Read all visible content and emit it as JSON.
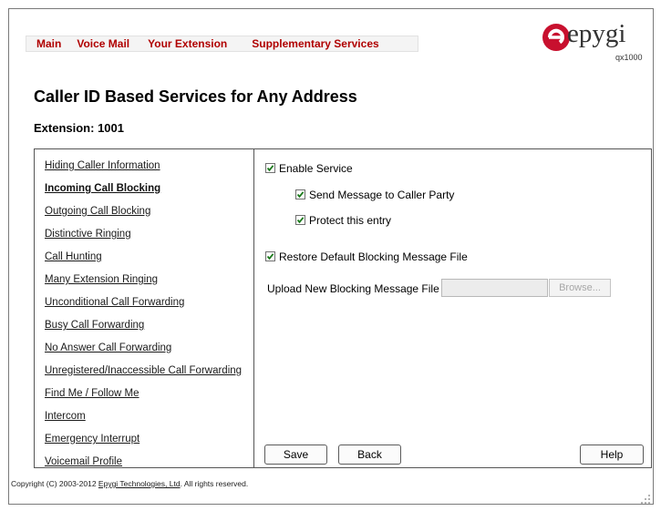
{
  "nav": {
    "tabs": [
      {
        "label": "Main"
      },
      {
        "label": "Voice Mail"
      },
      {
        "label": "Your Extension"
      },
      {
        "label": "Supplementary Services"
      }
    ]
  },
  "logo": {
    "word": "epygi",
    "model": "qx1000"
  },
  "page": {
    "title": "Caller ID Based Services for Any Address",
    "extension_label": "Extension: 1001"
  },
  "sidebar": {
    "items": [
      {
        "label": "Hiding Caller Information",
        "active": false
      },
      {
        "label": "Incoming Call Blocking",
        "active": true
      },
      {
        "label": "Outgoing Call Blocking",
        "active": false
      },
      {
        "label": "Distinctive Ringing",
        "active": false
      },
      {
        "label": "Call Hunting",
        "active": false
      },
      {
        "label": "Many Extension Ringing",
        "active": false
      },
      {
        "label": "Unconditional Call Forwarding",
        "active": false
      },
      {
        "label": "Busy Call Forwarding",
        "active": false
      },
      {
        "label": "No Answer Call Forwarding",
        "active": false
      },
      {
        "label": "Unregistered/Inaccessible Call Forwarding",
        "active": false
      },
      {
        "label": "Find Me / Follow Me",
        "active": false
      },
      {
        "label": "Intercom",
        "active": false
      },
      {
        "label": "Emergency Interrupt",
        "active": false
      },
      {
        "label": "Voicemail Profile",
        "active": false
      }
    ]
  },
  "form": {
    "enable_service": {
      "label": "Enable Service",
      "checked": true
    },
    "send_message": {
      "label": "Send Message to Caller Party",
      "checked": true
    },
    "protect_entry": {
      "label": "Protect this entry",
      "checked": true
    },
    "restore_default": {
      "label": "Restore Default Blocking Message File",
      "checked": true
    },
    "upload": {
      "label": "Upload New Blocking Message File",
      "value": "",
      "browse_label": "Browse..."
    }
  },
  "buttons": {
    "save": "Save",
    "back": "Back",
    "help": "Help"
  },
  "footer": {
    "prefix": "Copyright (C) 2003-2012 ",
    "link": "Epygi Technologies, Ltd",
    "suffix": ". All rights reserved."
  },
  "colors": {
    "tab_text": "#b00000",
    "logo_red": "#c8102e"
  }
}
